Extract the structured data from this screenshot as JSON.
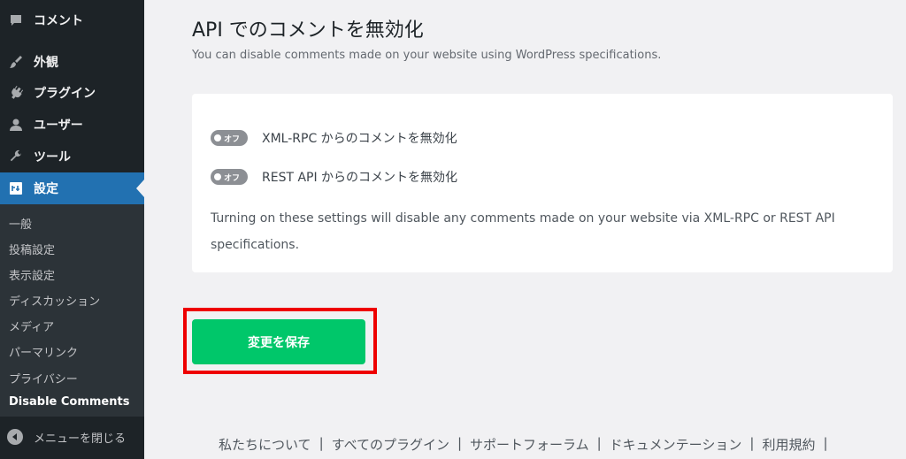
{
  "sidebar": {
    "menu": [
      {
        "label": "コメント",
        "icon": "comment-icon"
      },
      {
        "label": "外観",
        "icon": "paintbrush-icon"
      },
      {
        "label": "プラグイン",
        "icon": "plugin-icon"
      },
      {
        "label": "ユーザー",
        "icon": "user-icon"
      },
      {
        "label": "ツール",
        "icon": "wrench-icon"
      },
      {
        "label": "設定",
        "icon": "settings-icon"
      }
    ],
    "submenu": [
      "一般",
      "投稿設定",
      "表示設定",
      "ディスカッション",
      "メディア",
      "パーマリンク",
      "プライバシー",
      "Disable Comments"
    ],
    "collapse_label": "メニューを閉じる"
  },
  "main": {
    "title": "API でのコメントを無効化",
    "description": "You can disable comments made on your website using WordPress specifications.",
    "toggles": [
      {
        "state": "オフ",
        "label": "XML-RPC からのコメントを無効化"
      },
      {
        "state": "オフ",
        "label": "REST API からのコメントを無効化"
      }
    ],
    "help_text": "Turning on these settings will disable any comments made on your website via XML-RPC or REST API specifications.",
    "save_label": "変更を保存"
  },
  "footer": {
    "links": [
      "私たちについて",
      "すべてのプラグイン",
      "サポートフォーラム",
      "ドキュメンテーション",
      "利用規約"
    ],
    "separator": "|"
  },
  "colors": {
    "sidebar_bg": "#1d2327",
    "active_item": "#2271b1",
    "save_button": "#00c76a",
    "highlight_border": "#ee0000"
  }
}
